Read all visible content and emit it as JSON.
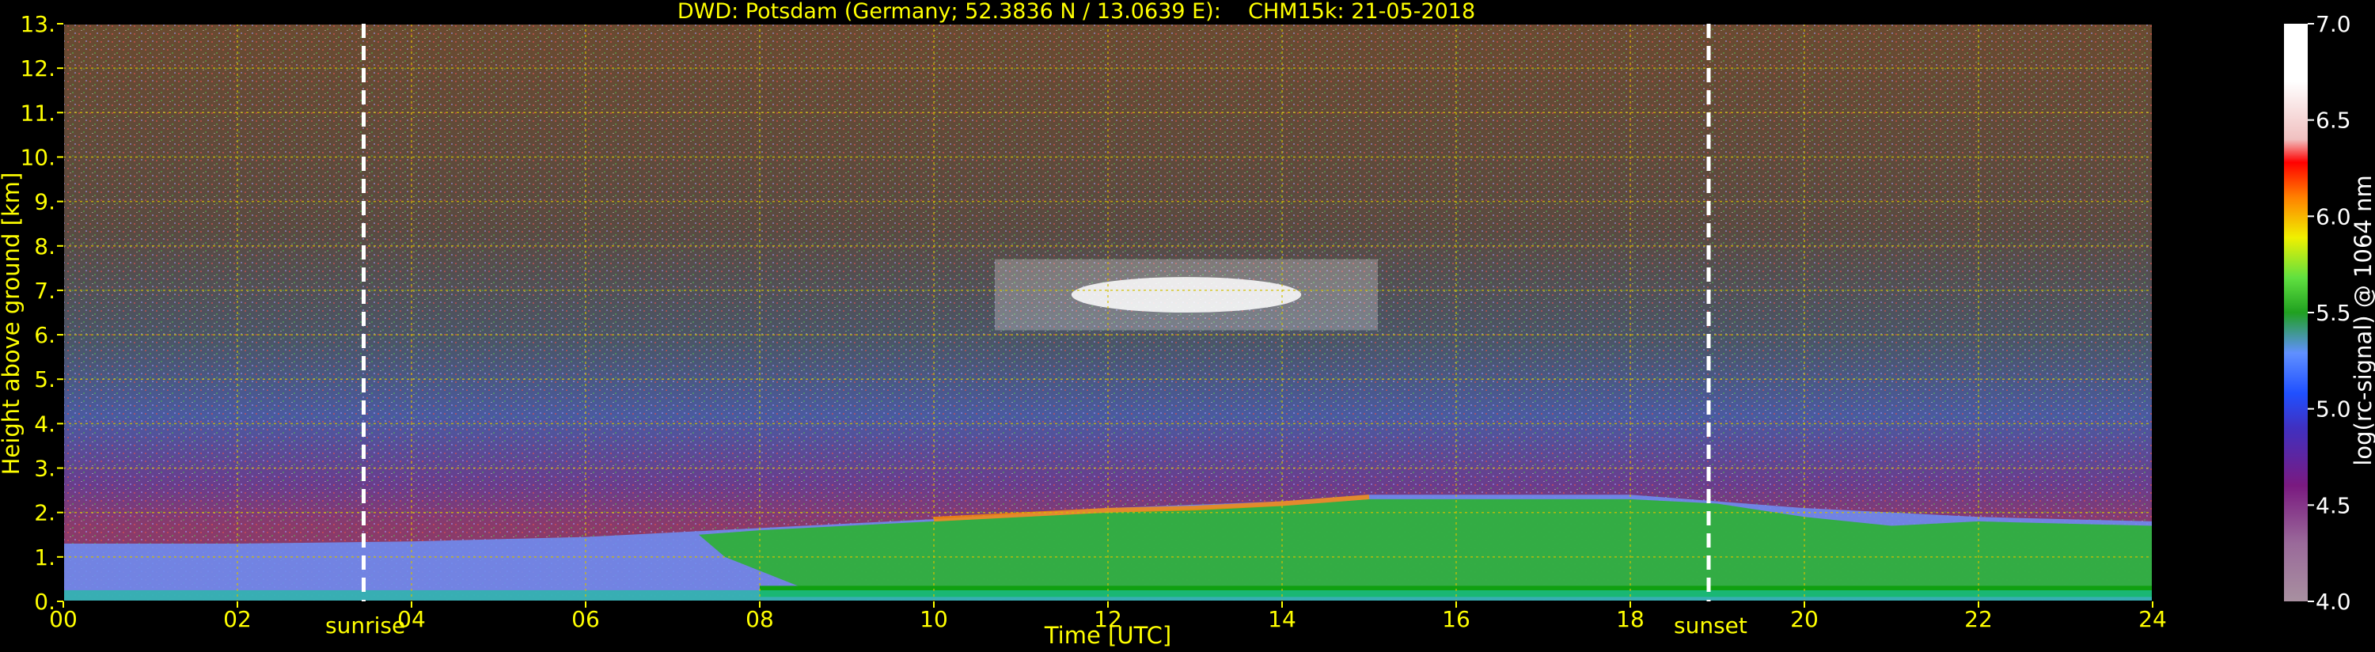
{
  "title": "DWD: Potsdam (Germany; 52.3836 N / 13.0639 E):    CHM15k: 21-05-2018",
  "chart_data": {
    "type": "heatmap",
    "title": "DWD: Potsdam (Germany; 52.3836 N / 13.0639 E):    CHM15k: 21-05-2018",
    "xlabel": "Time [UTC]",
    "ylabel": "Height above ground [km]",
    "x_range": [
      0,
      24
    ],
    "y_range": [
      0,
      13
    ],
    "x_ticks": [
      "00",
      "02",
      "04",
      "06",
      "08",
      "10",
      "12",
      "14",
      "16",
      "18",
      "20",
      "22",
      "24"
    ],
    "y_ticks": [
      "0.",
      "1.",
      "2.",
      "3.",
      "4.",
      "5.",
      "6.",
      "7.",
      "8.",
      "9.",
      "10.",
      "11.",
      "12.",
      "13."
    ],
    "grid": true,
    "colorbar": {
      "label": "log(rc-signal) @ 1064 nm",
      "range": [
        4.0,
        7.0
      ],
      "ticks": [
        "4.0",
        "4.5",
        "5.0",
        "5.5",
        "6.0",
        "6.5",
        "7.0"
      ]
    },
    "events": [
      {
        "label": "sunrise",
        "time": 3.45
      },
      {
        "label": "sunset",
        "time": 18.9
      }
    ],
    "boundary_layer_top_km": [
      {
        "time": 0,
        "height": 1.3
      },
      {
        "time": 2,
        "height": 1.3
      },
      {
        "time": 4,
        "height": 1.35
      },
      {
        "time": 6,
        "height": 1.45
      },
      {
        "time": 7.5,
        "height": 1.6
      },
      {
        "time": 8,
        "height": 1.65
      },
      {
        "time": 10,
        "height": 1.85
      },
      {
        "time": 12,
        "height": 2.1
      },
      {
        "time": 14,
        "height": 2.25
      },
      {
        "time": 15,
        "height": 2.4
      },
      {
        "time": 16,
        "height": 2.4
      },
      {
        "time": 18,
        "height": 2.4
      },
      {
        "time": 20,
        "height": 2.1
      },
      {
        "time": 22,
        "height": 1.9
      },
      {
        "time": 24,
        "height": 1.8
      }
    ],
    "cirrus_layer": {
      "time_range": [
        10.7,
        15.1
      ],
      "height_range": [
        6.1,
        7.7
      ]
    }
  }
}
